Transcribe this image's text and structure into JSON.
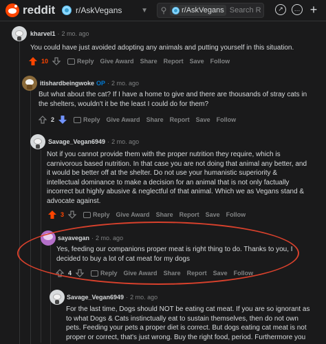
{
  "header": {
    "wordmark": "reddit",
    "subreddit": "r/AskVegans",
    "search_chip": "r/AskVegans",
    "search_placeholder": "Search R"
  },
  "colors": {
    "upvote": "#ff4500",
    "downvote": "#7193ff",
    "highlight": "#d9412c"
  },
  "actions": {
    "reply": "Reply",
    "award": "Give Award",
    "share": "Share",
    "report": "Report",
    "save": "Save",
    "follow": "Follow"
  },
  "comments": [
    {
      "user": "kharvel1",
      "time": "2 mo. ago",
      "lines": [
        "You could have just avoided adopting any animals and putting yourself in this situation."
      ],
      "score": "10",
      "vote": "up"
    },
    {
      "user": "itishardbeingwoke",
      "op": "OP",
      "time": "2 mo. ago",
      "lines": [
        "But what about the cat? If I have a home to give and there are thousands of stray cats in",
        "the shelters, wouldn't it be the least I could do for them?"
      ],
      "score": "2",
      "vote": "down"
    },
    {
      "user": "Savage_Vegan6949",
      "time": "2 mo. ago",
      "lines": [
        "Not if you cannot provide them with the proper nutrition they require, which is",
        "carnivorous based nutrition. In that case you are not doing that animal any better, and",
        "it would be better off at the shelter. Do not use your humanistic superiority &",
        "intellectual dominance to make a decision for an animal that is not only factually",
        "incorrect but highly abusive & neglectful of that animal. Which we as Vegans stand &",
        "advocate against."
      ],
      "score": "3",
      "vote": "up"
    },
    {
      "user": "sayavegan",
      "time": "2 mo. ago",
      "lines": [
        "Yes, feeding our companions proper meat is right thing to do. Thanks to you, I",
        "decided to buy a lot of cat meat for my dogs"
      ],
      "score": "4",
      "vote": "none"
    },
    {
      "user": "Savage_Vegan6949",
      "time": "2 mo. ago",
      "lines": [
        "For the last time, Dogs should NOT be eating cat meat. If you are so ignorant as",
        "to what Dogs & Cats instinctually eat to sustain themselves, then do not own",
        "pets. Feeding your pets a proper diet is correct. But dogs eating cat meat is not",
        "proper or correct, that's just wrong. Buy the right food, period. Furthermore you"
      ]
    }
  ]
}
